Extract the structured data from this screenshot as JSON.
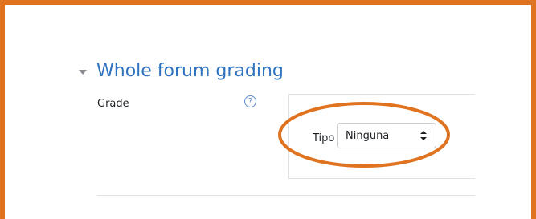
{
  "section": {
    "title": "Whole forum grading"
  },
  "grade_field": {
    "label": "Grade",
    "help_icon": "question-circle-icon",
    "type_label": "Tipo",
    "select_value": "Ninguna"
  },
  "colors": {
    "frame": "#e0731f",
    "title": "#2e72c0",
    "highlight": "#e0731f"
  }
}
